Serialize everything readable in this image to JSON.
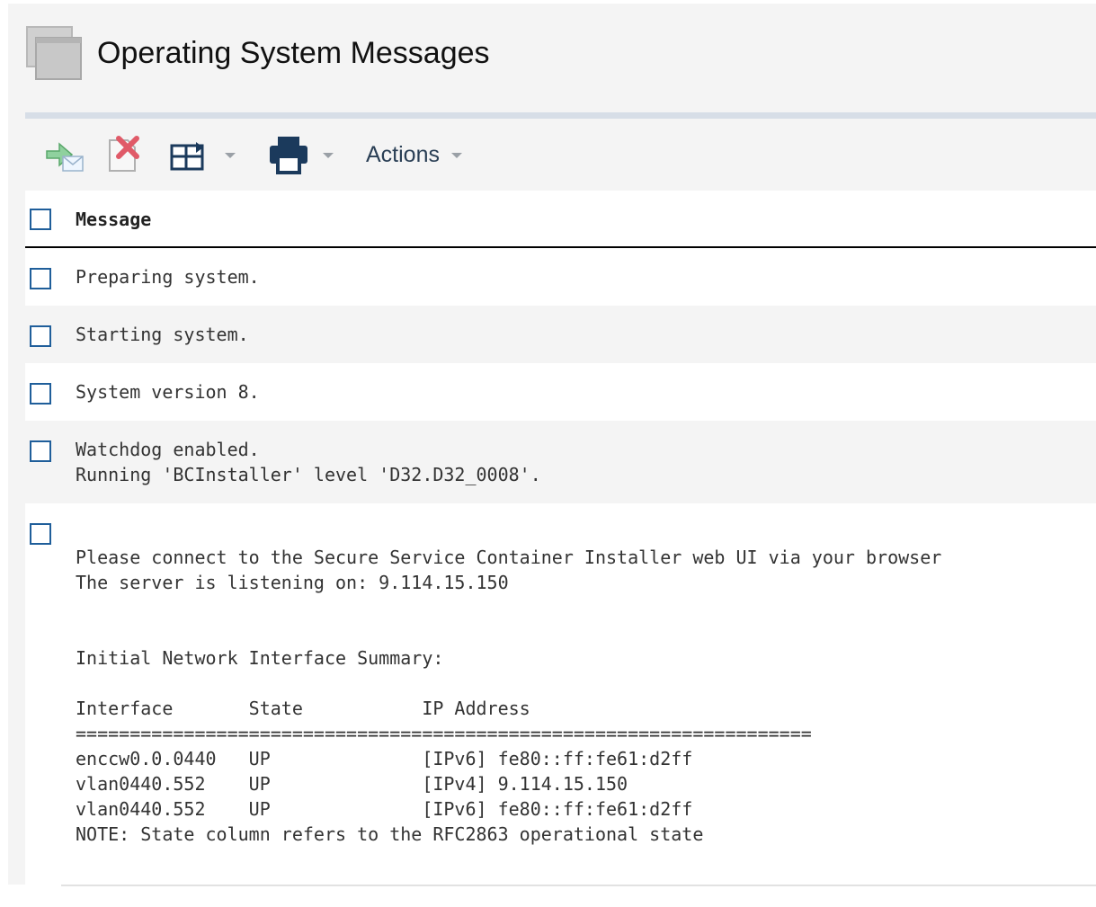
{
  "page": {
    "title": "Operating System Messages"
  },
  "toolbar": {
    "actions_label": "Actions",
    "icons": [
      "import-icon",
      "delete-icon",
      "columns-icon",
      "print-icon"
    ]
  },
  "table": {
    "column_header": "Message",
    "rows": [
      {
        "text": "Preparing system."
      },
      {
        "text": "Starting system."
      },
      {
        "text": "System version 8."
      },
      {
        "text": "Watchdog enabled.\nRunning 'BCInstaller' level 'D32.D32_0008'."
      },
      {
        "text": "\nPlease connect to the Secure Service Container Installer web UI via your browser\nThe server is listening on: 9.114.15.150\n\n\nInitial Network Interface Summary:\n\nInterface       State           IP Address\n====================================================================\nenccw0.0.0440   UP              [IPv6] fe80::ff:fe61:d2ff\nvlan0440.552    UP              [IPv4] 9.114.15.150\nvlan0440.552    UP              [IPv6] fe80::ff:fe61:d2ff\nNOTE: State column refers to the RFC2863 operational state"
      }
    ]
  },
  "colors": {
    "checkbox_border": "#1f5e9a",
    "row_alt": "#f4f4f4",
    "header_rule": "#d7dee7"
  }
}
